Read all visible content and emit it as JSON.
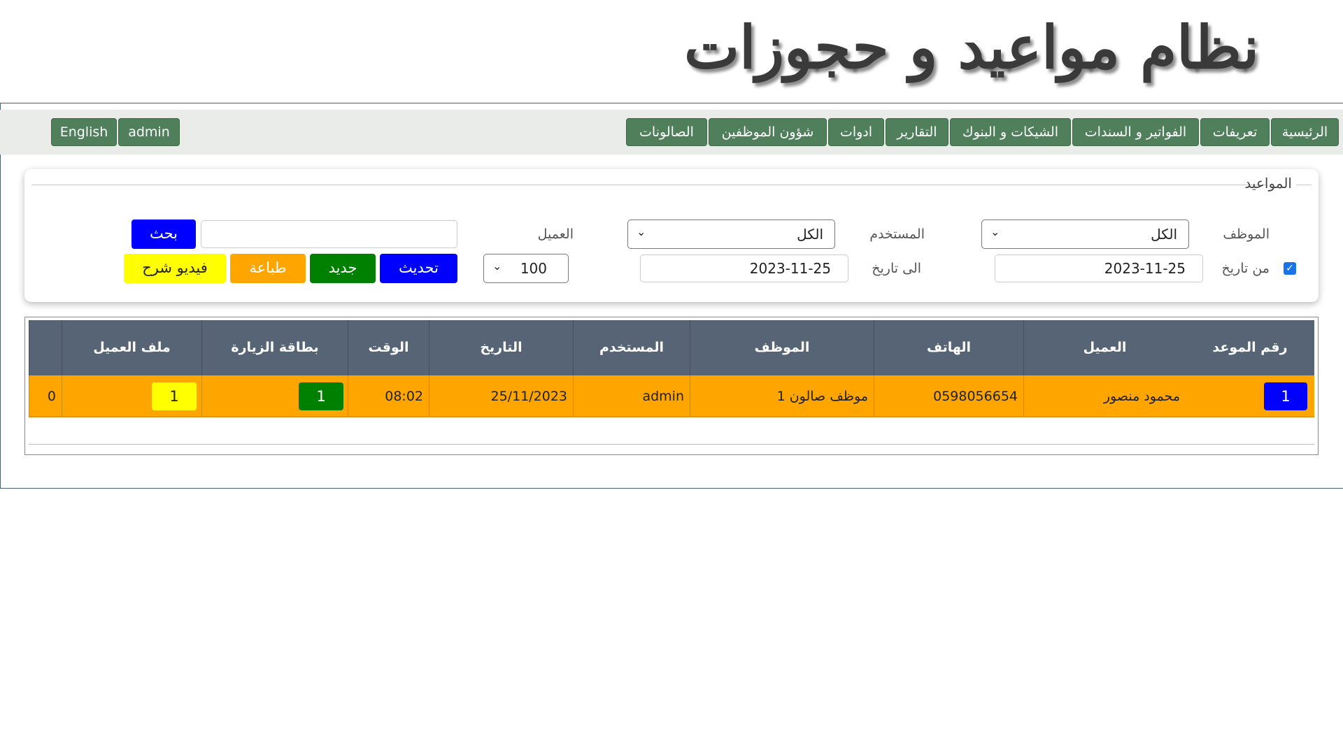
{
  "app": {
    "title": "نظام مواعيد و حجوزات"
  },
  "nav": {
    "items": [
      {
        "label": "الرئيسية"
      },
      {
        "label": "تعريفات"
      },
      {
        "label": "الفواتير و السندات"
      },
      {
        "label": "الشيكات و البنوك"
      },
      {
        "label": "التقارير"
      },
      {
        "label": "ادوات"
      },
      {
        "label": "شؤون الموظفين"
      },
      {
        "label": "الصالونات"
      }
    ],
    "user": "admin",
    "language": "English"
  },
  "filters": {
    "legend": "المواعيد",
    "employee_label": "الموظف",
    "employee_value": "الكل",
    "user_label": "المستخدم",
    "user_value": "الكل",
    "client_label": "العميل",
    "client_value": "",
    "search_label": "بحث",
    "from_date_label": "من تاريخ",
    "from_date_value": "2023-11-25",
    "from_date_checked": true,
    "to_date_label": "الى تاريخ",
    "to_date_value": "2023-11-25",
    "page_size": "100",
    "refresh_label": "تحديث",
    "new_label": "جديد",
    "print_label": "طباعة",
    "video_label": "فيديو شرح"
  },
  "table": {
    "headers": [
      "رقم الموعد",
      "العميل",
      "الهاتف",
      "الموظف",
      "المستخدم",
      "التاريخ",
      "الوقت",
      "بطاقة الزيارة",
      "ملف العميل"
    ],
    "rows": [
      {
        "id": "1",
        "client": "محمود منصور",
        "phone": "0598056654",
        "employee": "موظف صالون 1",
        "user": "admin",
        "date": "25/11/2023",
        "time": "08:02",
        "visit_card": "1",
        "client_file": "1",
        "extra": "0"
      }
    ]
  },
  "colors": {
    "nav_button": "#4f7f5b",
    "table_header": "#566475",
    "row_highlight": "#ffa500",
    "blue_button": "#0000ff",
    "green_button": "#008000",
    "orange_button": "#ffa500",
    "yellow_button": "#ffff00"
  }
}
